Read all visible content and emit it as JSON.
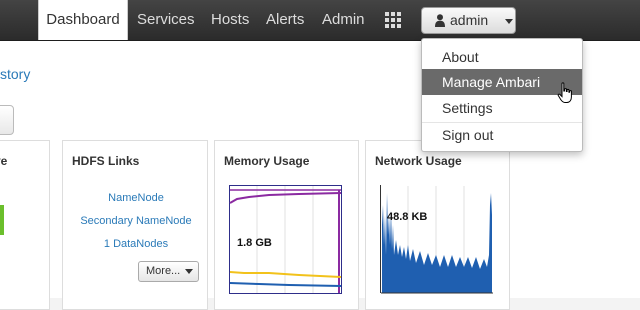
{
  "nav": {
    "items": [
      {
        "label": "Dashboard",
        "active": true
      },
      {
        "label": "Services",
        "active": false
      },
      {
        "label": "Hosts",
        "active": false
      },
      {
        "label": "Alerts",
        "active": false
      },
      {
        "label": "Admin",
        "active": false
      }
    ],
    "apps_icon": "grid-icon",
    "user_label": "admin"
  },
  "user_menu": {
    "items": [
      {
        "label": "About"
      },
      {
        "label": "Manage Ambari",
        "hovered": true
      },
      {
        "label": "Settings"
      },
      {
        "label": "Sign out"
      }
    ]
  },
  "page": {
    "history_link": "story"
  },
  "widgets": {
    "partial_title": "ve",
    "hdfs": {
      "title": "HDFS Links",
      "links": [
        "NameNode",
        "Secondary NameNode",
        "1 DataNodes"
      ],
      "more_label": "More..."
    },
    "memory": {
      "title": "Memory Usage",
      "value_label": "1.8 GB",
      "colors": {
        "purple": "#8b2aa1",
        "yellow": "#f2c21b",
        "blue": "#1f5fb0",
        "frame": "#2e2e8a"
      }
    },
    "network": {
      "title": "Network Usage",
      "value_label": "48.8 KB",
      "colors": {
        "blue": "#1f5fb0",
        "green": "#3ab54a"
      }
    }
  },
  "colors": {
    "link": "#2a7ab8",
    "topbar": "#333333",
    "accent_green": "#6bbf2c"
  }
}
